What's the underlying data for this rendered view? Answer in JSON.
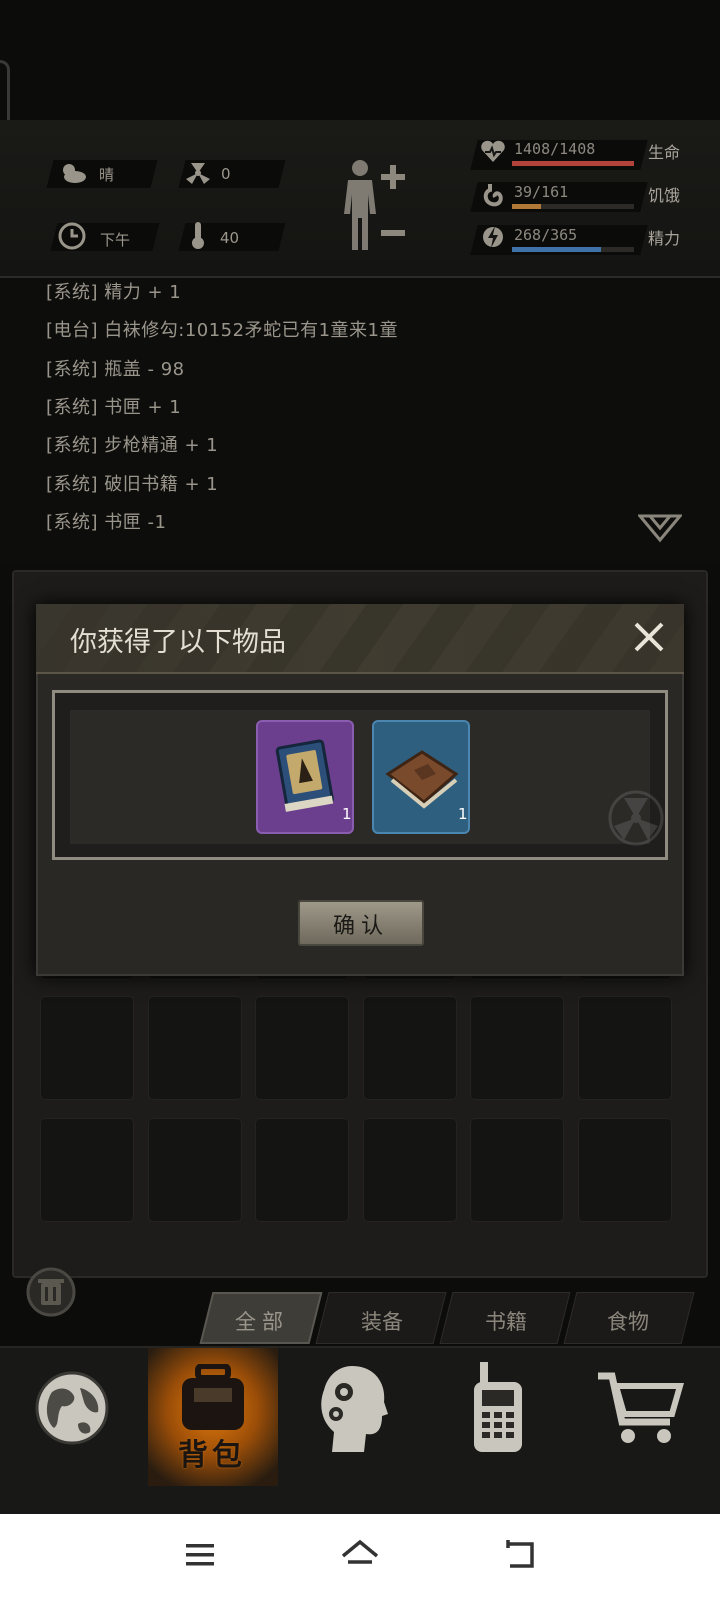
{
  "status": {
    "weather": "晴",
    "radiation": "0",
    "time_of_day": "下午",
    "temperature": "40",
    "health": {
      "value": "1408/1408",
      "label": "生命",
      "fraction": 1.0,
      "color": "#b1433a"
    },
    "hunger": {
      "value": "39/161",
      "label": "饥饿",
      "fraction": 0.24,
      "color": "#b07a36"
    },
    "energy": {
      "value": "268/365",
      "label": "精力",
      "fraction": 0.73,
      "color": "#3f72a8"
    }
  },
  "log": {
    "lines": [
      "[系统] 精力 + 1",
      "[电台] 白袜修勾:10152矛蛇已有1童来1童",
      "[系统] 瓶盖 - 98",
      "[系统] 书匣 + 1",
      "[系统] 步枪精通 + 1",
      "[系统] 破旧书籍 + 1",
      "[系统] 书匣 -1"
    ]
  },
  "modal": {
    "title": "你获得了以下物品",
    "items": [
      {
        "name": "skill-book",
        "count": "1",
        "rarity_color": "#6b3f8e"
      },
      {
        "name": "old-book",
        "count": "1",
        "rarity_color": "#2f5f7f"
      }
    ],
    "confirm_label": "确认"
  },
  "tabs": [
    "全部",
    "装备",
    "书籍",
    "食物"
  ],
  "nav": {
    "backpack_label": "背包"
  }
}
